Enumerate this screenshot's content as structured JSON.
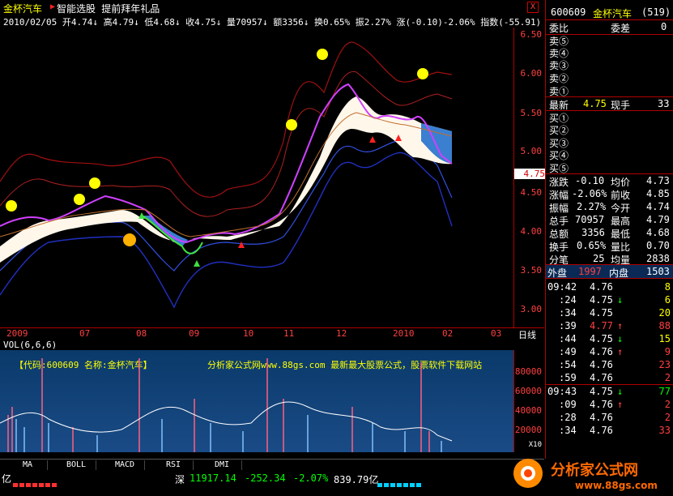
{
  "header": {
    "stock_name": "金杯汽车",
    "marker": "▶",
    "links": "智能选股 提前拜年礼品",
    "close": "X"
  },
  "infobar": {
    "date": "2010/02/05",
    "open": "开4.74",
    "open_arrow": "↓",
    "high": "高4.79",
    "high_arrow": "↓",
    "low": "低4.68",
    "low_arrow": "↓",
    "close": "收4.75",
    "close_arrow": "↓",
    "volume": "量70957",
    "volume_arrow": "↓",
    "amount": "额3356",
    "amount_arrow": "↓",
    "turnover": "换0.65%",
    "amplitude": "振2.27%",
    "change": "涨(-0.10)-2.06%",
    "index": "指数(-55.91)"
  },
  "y_axis": [
    "6.50",
    "6.00",
    "5.50",
    "5.00",
    "4.50",
    "4.00",
    "3.50",
    "3.00"
  ],
  "price_tag": "4.75",
  "x_axis": [
    "2009",
    "07",
    "08",
    "09",
    "10",
    "11",
    "12",
    "2010",
    "02",
    "03"
  ],
  "x_axis_right": "日线",
  "volume": {
    "header": "VOL(6,6,6)",
    "label1": "【代码:600609 名称:金杯汽车】",
    "label2": "分析家公式网www.88gs.com 最新最大股票公式，股票软件下载网站",
    "y_axis": [
      "80000",
      "60000",
      "40000",
      "20000"
    ],
    "unit": "X10"
  },
  "tabs": [
    "MA",
    "BOLL",
    "MACD",
    "RSI",
    "DMI"
  ],
  "status": {
    "left": "亿",
    "exchange": "深",
    "index": "11917.14",
    "change": "-252.34",
    "pct": "-2.07%",
    "amount": "839.79亿"
  },
  "quote": {
    "code": "600609",
    "name": "金杯汽车",
    "num": "(519)",
    "weibi_label": "委比",
    "weicha_label": "委差",
    "weicha_value": "0",
    "sells": [
      "卖⑤",
      "卖④",
      "卖③",
      "卖②",
      "卖①"
    ],
    "latest_label": "最新",
    "latest_value": "4.75",
    "xianshou_label": "现手",
    "xianshou_value": "33",
    "buys": [
      "买①",
      "买②",
      "买③",
      "买④",
      "买⑤"
    ],
    "stats": [
      {
        "l1": "涨跌",
        "v1": "-0.10",
        "l2": "均价",
        "v2": "4.73"
      },
      {
        "l1": "涨幅",
        "v1": "-2.06%",
        "l2": "前收",
        "v2": "4.85"
      },
      {
        "l1": "振幅",
        "v1": "2.27%",
        "l2": "今开",
        "v2": "4.74"
      },
      {
        "l1": "总手",
        "v1": "70957",
        "l2": "最高",
        "v2": "4.79"
      },
      {
        "l1": "总额",
        "v1": "3356",
        "l2": "最低",
        "v2": "4.68"
      },
      {
        "l1": "换手",
        "v1": "0.65%",
        "l2": "量比",
        "v2": "0.70"
      },
      {
        "l1": "分笔",
        "v1": "25",
        "l2": "均量",
        "v2": "2838"
      }
    ],
    "outer_label": "外盘",
    "outer_value": "1997",
    "inner_label": "内盘",
    "inner_value": "1503",
    "ticks": [
      {
        "t": "09:42",
        "p": "4.76",
        "d": "",
        "v": "8"
      },
      {
        "t": ":24",
        "p": "4.75",
        "d": "↓",
        "v": "6"
      },
      {
        "t": ":34",
        "p": "4.75",
        "d": "",
        "v": "20"
      },
      {
        "t": ":39",
        "p": "4.77",
        "d": "↑",
        "v": "88"
      },
      {
        "t": ":44",
        "p": "4.75",
        "d": "↓",
        "v": "15"
      },
      {
        "t": ":49",
        "p": "4.76",
        "d": "↑",
        "v": "9"
      },
      {
        "t": ":54",
        "p": "4.76",
        "d": "",
        "v": "23"
      },
      {
        "t": ":59",
        "p": "4.76",
        "d": "",
        "v": "2"
      },
      {
        "t": "09:43",
        "p": "4.75",
        "d": "↓",
        "v": "77"
      },
      {
        "t": ":09",
        "p": "4.76",
        "d": "↑",
        "v": "2"
      },
      {
        "t": ":28",
        "p": "4.76",
        "d": "",
        "v": "2"
      },
      {
        "t": ":34",
        "p": "4.76",
        "d": "",
        "v": "33"
      }
    ]
  },
  "logo": {
    "text": "分析家公式网",
    "url": "www.88gs.com"
  }
}
